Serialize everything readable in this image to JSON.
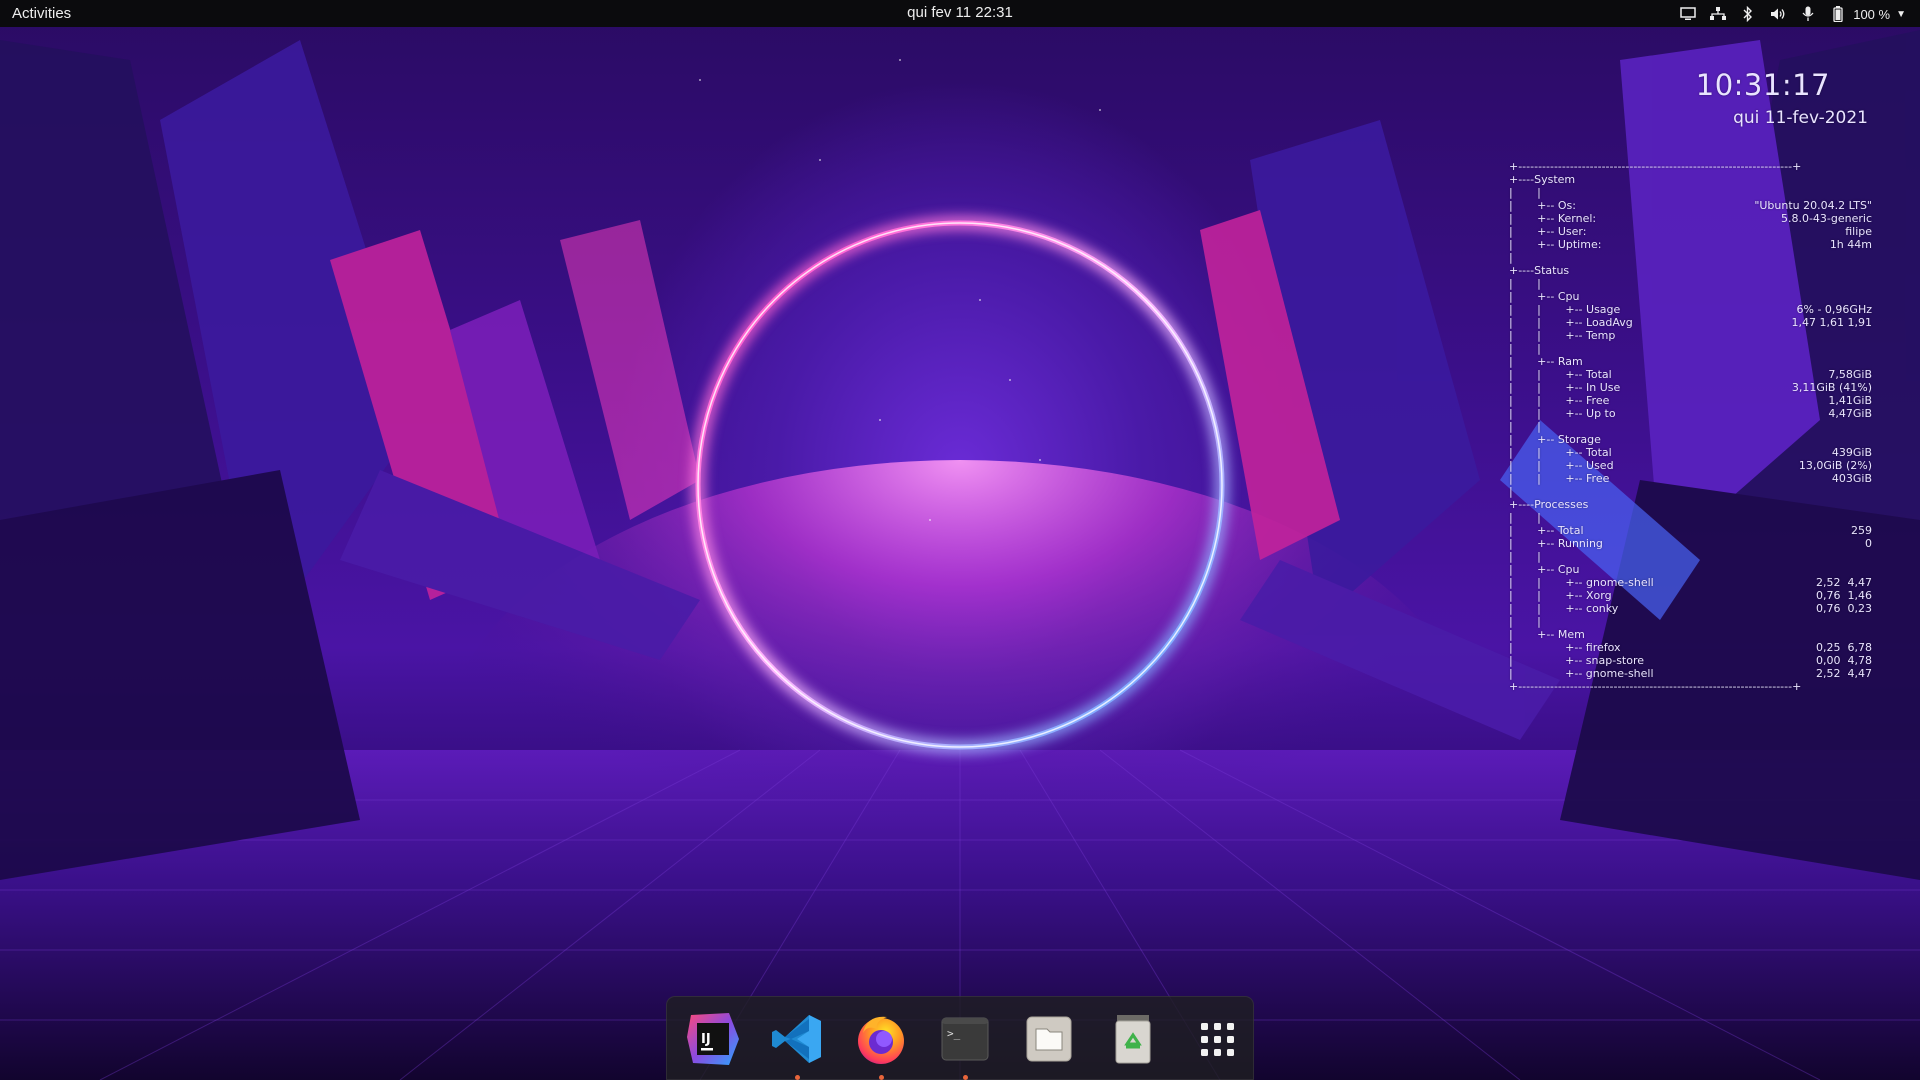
{
  "topbar": {
    "activities": "Activities",
    "datetime": "qui fev 11  22:31",
    "battery": "100 %",
    "icons": [
      "screen-icon",
      "network-icon",
      "bluetooth-icon",
      "volume-icon",
      "microphone-icon",
      "battery-icon",
      "dropdown-caret-icon"
    ]
  },
  "conky": {
    "time": "10:31:17",
    "date": "qui 11-fev-2021",
    "border_top": "+---------------------------------------------------------------------+",
    "border_bottom": "+---------------------------------------------------------------------+",
    "rows": [
      {
        "l": "+----System",
        "v": ""
      },
      {
        "l": "|       |",
        "v": ""
      },
      {
        "l": "|       +-- Os:",
        "v": "\"Ubuntu 20.04.2 LTS\""
      },
      {
        "l": "|       +-- Kernel:",
        "v": "5.8.0-43-generic"
      },
      {
        "l": "|       +-- User:",
        "v": "filipe"
      },
      {
        "l": "|       +-- Uptime:",
        "v": "1h 44m"
      },
      {
        "l": "|",
        "v": ""
      },
      {
        "l": "+----Status",
        "v": ""
      },
      {
        "l": "|       |",
        "v": ""
      },
      {
        "l": "|       +-- Cpu",
        "v": ""
      },
      {
        "l": "|       |       +-- Usage",
        "v": "6% - 0,96GHz"
      },
      {
        "l": "|       |       +-- LoadAvg",
        "v": "1,47 1,61 1,91"
      },
      {
        "l": "|       |       +-- Temp",
        "v": ""
      },
      {
        "l": "|       |",
        "v": ""
      },
      {
        "l": "|       +-- Ram",
        "v": ""
      },
      {
        "l": "|       |       +-- Total",
        "v": "7,58GiB"
      },
      {
        "l": "|       |       +-- In Use",
        "v": "3,11GiB (41%)"
      },
      {
        "l": "|       |       +-- Free",
        "v": "1,41GiB"
      },
      {
        "l": "|       |       +-- Up to",
        "v": "4,47GiB"
      },
      {
        "l": "|       |",
        "v": ""
      },
      {
        "l": "|       +-- Storage",
        "v": ""
      },
      {
        "l": "|       |       +-- Total",
        "v": "439GiB"
      },
      {
        "l": "|       |       +-- Used",
        "v": "13,0GiB (2%)"
      },
      {
        "l": "|       |       +-- Free",
        "v": "403GiB"
      },
      {
        "l": "|",
        "v": ""
      },
      {
        "l": "+----Processes",
        "v": ""
      },
      {
        "l": "|       |",
        "v": ""
      },
      {
        "l": "|       +-- Total",
        "v": "259"
      },
      {
        "l": "|       +-- Running",
        "v": "0"
      },
      {
        "l": "|       |",
        "v": ""
      },
      {
        "l": "|       +-- Cpu",
        "v": ""
      },
      {
        "l": "|       |       +-- gnome-shell",
        "v": "2,52  4,47"
      },
      {
        "l": "|       |       +-- Xorg",
        "v": "0,76  1,46"
      },
      {
        "l": "|       |       +-- conky",
        "v": "0,76  0,23"
      },
      {
        "l": "|       |",
        "v": ""
      },
      {
        "l": "|       +-- Mem",
        "v": ""
      },
      {
        "l": "|               +-- firefox",
        "v": "0,25  6,78"
      },
      {
        "l": "|               +-- snap-store",
        "v": "0,00  4,78"
      },
      {
        "l": "|               +-- gnome-shell",
        "v": "2,52  4,47"
      }
    ]
  },
  "dock": {
    "items": [
      {
        "name": "intellij-idea-icon",
        "running": false
      },
      {
        "name": "vscode-icon",
        "running": true
      },
      {
        "name": "firefox-icon",
        "running": true
      },
      {
        "name": "terminal-icon",
        "running": true
      },
      {
        "name": "files-icon",
        "running": false
      },
      {
        "name": "trash-icon",
        "running": false
      },
      {
        "name": "show-applications-icon",
        "running": false
      }
    ],
    "terminal_prompt": ">_",
    "intellij_label": "IJ"
  },
  "colors": {
    "neon_ring_pink": "#ff3fbf",
    "neon_ring_blue": "#4fa8ff",
    "topbar_bg": "#0b0b0d",
    "dock_run_dot": "#e8653b"
  }
}
